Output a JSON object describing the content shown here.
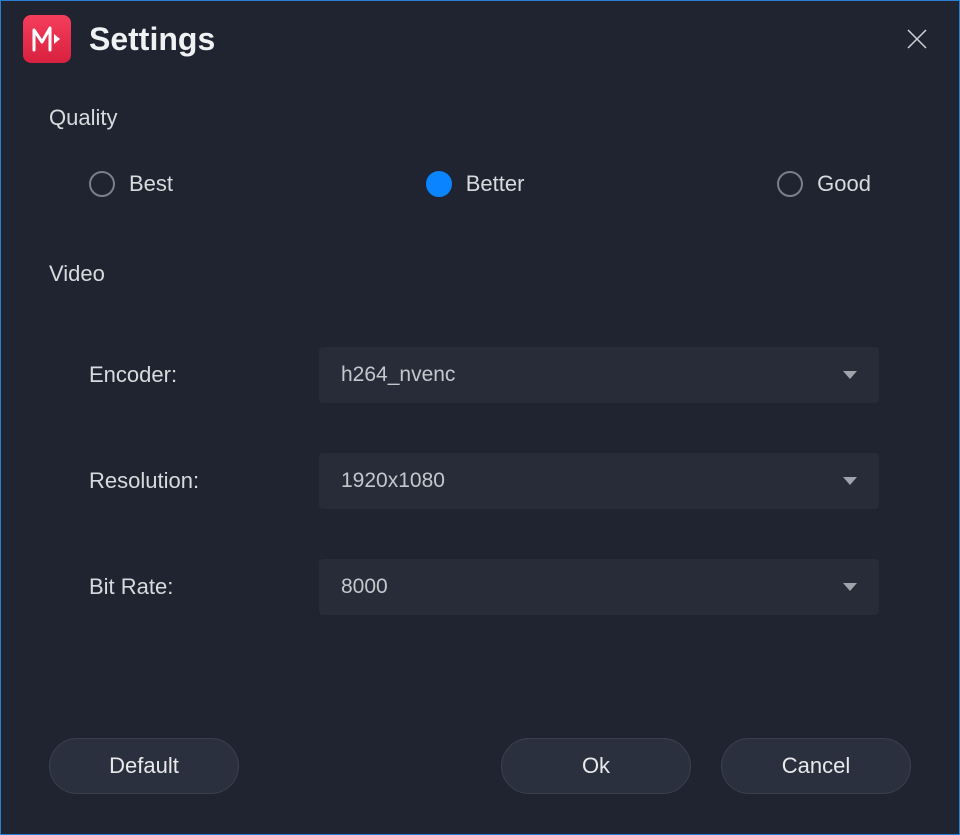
{
  "window": {
    "title": "Settings"
  },
  "quality": {
    "section_label": "Quality",
    "options": [
      {
        "label": "Best",
        "selected": false
      },
      {
        "label": "Better",
        "selected": true
      },
      {
        "label": "Good",
        "selected": false
      }
    ]
  },
  "video": {
    "section_label": "Video",
    "encoder": {
      "label": "Encoder:",
      "value": "h264_nvenc"
    },
    "resolution": {
      "label": "Resolution:",
      "value": "1920x1080"
    },
    "bitrate": {
      "label": "Bit Rate:",
      "value": "8000"
    }
  },
  "buttons": {
    "default": "Default",
    "ok": "Ok",
    "cancel": "Cancel"
  },
  "colors": {
    "accent": "#0a84ff",
    "background": "#1f2430",
    "panel": "#272c38",
    "border": "#2a7fd4",
    "app_icon_bg": "#f43e5c"
  }
}
